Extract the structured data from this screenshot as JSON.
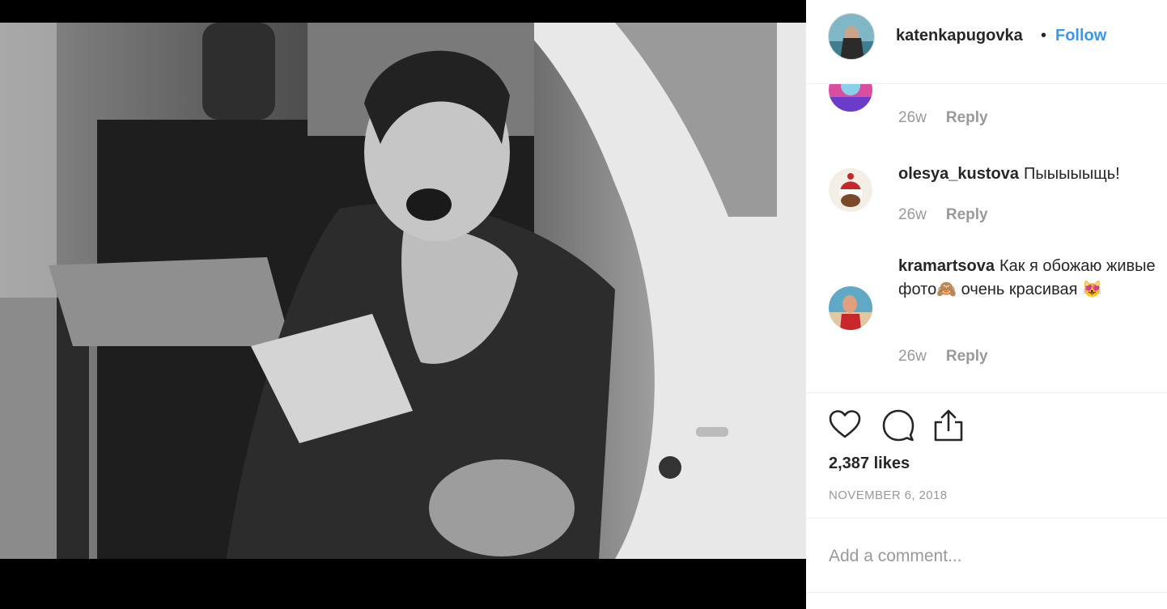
{
  "post": {
    "author": "katenkapugovka",
    "separator": "•",
    "follow_label": "Follow",
    "photo": "black-and-white-photo-woman-in-car"
  },
  "comments": [
    {
      "username": "",
      "text": "",
      "time": "26w",
      "reply_label": "Reply"
    },
    {
      "username": "olesya_kustova",
      "text": "Пыыыыыщь!",
      "time": "26w",
      "reply_label": "Reply"
    },
    {
      "username": "kramartsova",
      "text": "Как я обожаю живые фото🙈 очень красивая 😻",
      "time": "26w",
      "reply_label": "Reply"
    }
  ],
  "actions": {
    "like_icon": "heart-icon",
    "comment_icon": "comment-bubble-icon",
    "share_icon": "share-upload-icon"
  },
  "likes": "2,387 likes",
  "date": "NOVEMBER 6, 2018",
  "add_comment": {
    "placeholder": "Add a comment..."
  },
  "colors": {
    "link": "#3897f0",
    "text": "#262626",
    "muted": "#999999",
    "border": "#efefef"
  }
}
